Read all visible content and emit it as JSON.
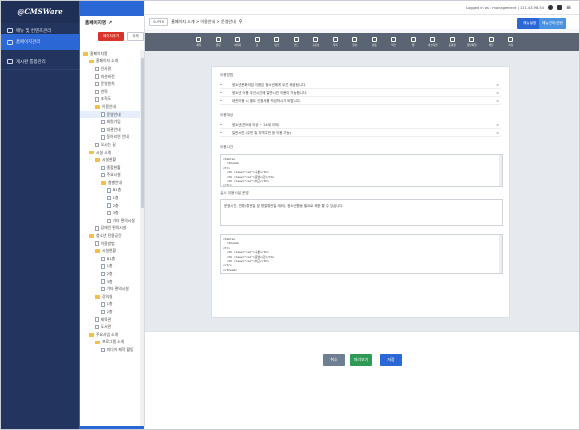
{
  "app": {
    "logo": "@CMSWare"
  },
  "topbar": {
    "user_text": "Logged in as : management | 121.43.98.54"
  },
  "lnav": {
    "items": [
      {
        "label": "메뉴 및 컨텐츠관리"
      },
      {
        "label": "홈페이지관리"
      },
      {
        "label": "게시판 통합관리"
      }
    ]
  },
  "tree": {
    "title": "홈페이지명",
    "btn_add": "페이지추가",
    "btn_del": "삭제",
    "nodes": [
      {
        "label": "홈페이지명",
        "indent": 0,
        "type": "folder"
      },
      {
        "label": "홈페이지 소개",
        "indent": 1,
        "type": "folder"
      },
      {
        "label": "인사말",
        "indent": 2,
        "type": "doc"
      },
      {
        "label": "미션비전",
        "indent": 2,
        "type": "doc"
      },
      {
        "label": "운영원칙",
        "indent": 2,
        "type": "doc"
      },
      {
        "label": "연혁",
        "indent": 2,
        "type": "doc"
      },
      {
        "label": "조직도",
        "indent": 2,
        "type": "doc"
      },
      {
        "label": "이용안내",
        "indent": 2,
        "type": "folder"
      },
      {
        "label": "운영안내",
        "indent": 3,
        "type": "doc"
      },
      {
        "label": "회원가입",
        "indent": 3,
        "type": "doc"
      },
      {
        "label": "대관안내",
        "indent": 3,
        "type": "doc"
      },
      {
        "label": "동아리연 안내",
        "indent": 3,
        "type": "doc"
      },
      {
        "label": "오시는 길",
        "indent": 2,
        "type": "doc"
      },
      {
        "label": "시설 소개",
        "indent": 1,
        "type": "folder"
      },
      {
        "label": "시설현황",
        "indent": 2,
        "type": "folder"
      },
      {
        "label": "종합현황",
        "indent": 3,
        "type": "doc"
      },
      {
        "label": "주요시설",
        "indent": 3,
        "type": "doc"
      },
      {
        "label": "층별안내",
        "indent": 3,
        "type": "folder"
      },
      {
        "label": "B1층",
        "indent": 4,
        "type": "doc"
      },
      {
        "label": "1층",
        "indent": 4,
        "type": "doc"
      },
      {
        "label": "2층",
        "indent": 4,
        "type": "doc"
      },
      {
        "label": "3층",
        "indent": 4,
        "type": "doc"
      },
      {
        "label": "기타 편의시설",
        "indent": 4,
        "type": "doc"
      },
      {
        "label": "장애인 편의시설",
        "indent": 2,
        "type": "doc"
      },
      {
        "label": "청소년 전용공간",
        "indent": 1,
        "type": "folder"
      },
      {
        "label": "이용방법",
        "indent": 2,
        "type": "doc"
      },
      {
        "label": "시설현황",
        "indent": 2,
        "type": "folder"
      },
      {
        "label": "B1층",
        "indent": 3,
        "type": "doc"
      },
      {
        "label": "1층",
        "indent": 3,
        "type": "doc"
      },
      {
        "label": "2층",
        "indent": 3,
        "type": "doc"
      },
      {
        "label": "3층",
        "indent": 3,
        "type": "doc"
      },
      {
        "label": "기타 편의시설",
        "indent": 3,
        "type": "doc"
      },
      {
        "label": "강의실",
        "indent": 2,
        "type": "folder"
      },
      {
        "label": "1층",
        "indent": 3,
        "type": "doc"
      },
      {
        "label": "2층",
        "indent": 3,
        "type": "doc"
      },
      {
        "label": "체육관",
        "indent": 2,
        "type": "doc"
      },
      {
        "label": "도서관",
        "indent": 2,
        "type": "doc"
      },
      {
        "label": "주요사업 소개",
        "indent": 1,
        "type": "folder"
      },
      {
        "label": "프로그램 소개",
        "indent": 2,
        "type": "folder"
      },
      {
        "label": "미디어 제작 활동",
        "indent": 3,
        "type": "doc"
      }
    ]
  },
  "crumb": {
    "prefix": "SUPER",
    "path": "홈페이지 소개 > 이용안내 > 운영안내"
  },
  "header_buttons": {
    "menu_setting": "메뉴설정",
    "menu_preview": "메뉴관리/권한"
  },
  "toolbar": {
    "tools": [
      "제목",
      "본문",
      "이미지",
      "표",
      "링크",
      "코드",
      "구분선",
      "목록",
      "번호",
      "인용",
      "박스",
      "탭",
      "아코디언",
      "동영상",
      "첨부파일",
      "버튼",
      "기타"
    ]
  },
  "editor": {
    "sec1_title": "이용방법",
    "sec1_rows": [
      "청소년문화의집 이용은 청소년에게 우선 제공됩니다.",
      "청소년 이용 우선시간에 일반시민 이용이 가능합니다.",
      "대관이용 시 별도 신청서를 작성하시기 바랍니다."
    ],
    "sec2_title": "이용대상",
    "sec2_rows": [
      "청소년(만9세 이상 ~ 24세 이하)",
      "일반시민 (주민 및 지역주민 등 이용 가능)"
    ],
    "sec3_title": "이용시간",
    "code1": [
      "<table>",
      "<thead>",
      "<tr>",
      "<th class=\"col\">구분</th>",
      "<th class=\"col\">운영시간</th>",
      "<th class=\"col\">비고</th>",
      "</tr>"
    ],
    "sec4_title": "실시 이용시설 운영",
    "textbox": "운영시간, 연휴(휴관일 및 명절휴관일 제외), 청소년활동 필요로 제한 할 수 있습니다.",
    "small": "...",
    "code2": [
      "<table>",
      "<thead>",
      "<tr>",
      "<th class=\"col\">구분</th>",
      "<th class=\"col\">운영시간</th>",
      "<th class=\"col\">비고</th>",
      "</tr>",
      "</thead>"
    ]
  },
  "actions": {
    "cancel": "취소",
    "preview": "미리보기",
    "save": "저장"
  },
  "colors": {
    "navy": "#23355e",
    "blue": "#2c67d6",
    "cancel": "#6f7e90",
    "preview": "#2f9a55",
    "save": "#2c67d6"
  }
}
